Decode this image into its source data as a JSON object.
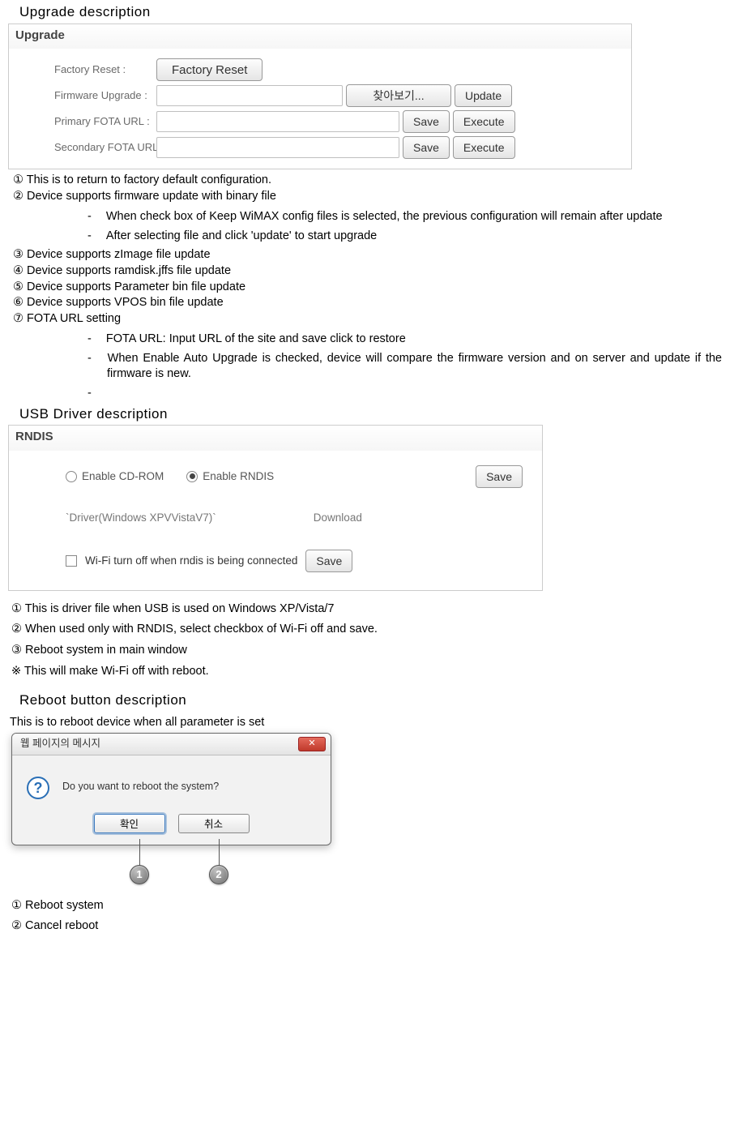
{
  "sections": {
    "upgrade_title": "Upgrade  description",
    "usb_title": "USB  Driver  description",
    "reboot_title": "Reboot  button  description",
    "reboot_intro": "This is to reboot device when all parameter is set"
  },
  "upgrade_panel": {
    "heading": "Upgrade",
    "rows": {
      "factory_label": "Factory Reset :",
      "factory_btn": "Factory Reset",
      "firmware_label": "Firmware Upgrade :",
      "browse_btn": "찾아보기...",
      "update_btn": "Update",
      "primary_label": "Primary FOTA URL :",
      "secondary_label": "Secondary FOTA URL :",
      "save_btn": "Save",
      "execute_btn": "Execute"
    }
  },
  "upgrade_notes": {
    "n1": "① This is to return to factory default configuration.",
    "n2": "② Device supports firmware update with binary file",
    "d2a": "When check box of Keep WiMAX config files is selected, the previous configuration will remain after update",
    "d2b": "After selecting file and click 'update' to start upgrade",
    "n3": "③ Device supports zImage file update",
    "n4": "④ Device supports ramdisk.jffs file update",
    "n5": "⑤ Device supports Parameter bin file update",
    "n6": "⑥ Device supports VPOS bin file update",
    "n7": "⑦ FOTA URL setting",
    "d7a": "FOTA URL: Input URL of the site and save click to restore",
    "d7b": "When Enable Auto Upgrade is checked, device will compare the firmware version and on server and update if the firmware is new."
  },
  "rndis_panel": {
    "heading": "RNDIS",
    "opt_cdrom": "Enable CD-ROM",
    "opt_rndis": "Enable RNDIS",
    "save_btn": "Save",
    "driver_label": "`Driver(Windows XPVVistaV7)`",
    "download_label": "Download",
    "wifi_off_label": "Wi-Fi turn off when rndis is being connected"
  },
  "usb_notes": {
    "n1": "①  This is driver file when USB is used on Windows XP/Vista/7",
    "n2": "②  When used only with RNDIS, select checkbox of Wi-Fi off and save.",
    "n3": "③  Reboot system in main window",
    "n4": "※   This will make Wi-Fi off with reboot."
  },
  "dialog": {
    "title": "웹 페이지의 메시지",
    "message": "Do you want to reboot the system?",
    "ok": "확인",
    "cancel": "취소",
    "callout1": "1",
    "callout2": "2"
  },
  "reboot_notes": {
    "n1": "①  Reboot system",
    "n2": "②  Cancel reboot"
  }
}
